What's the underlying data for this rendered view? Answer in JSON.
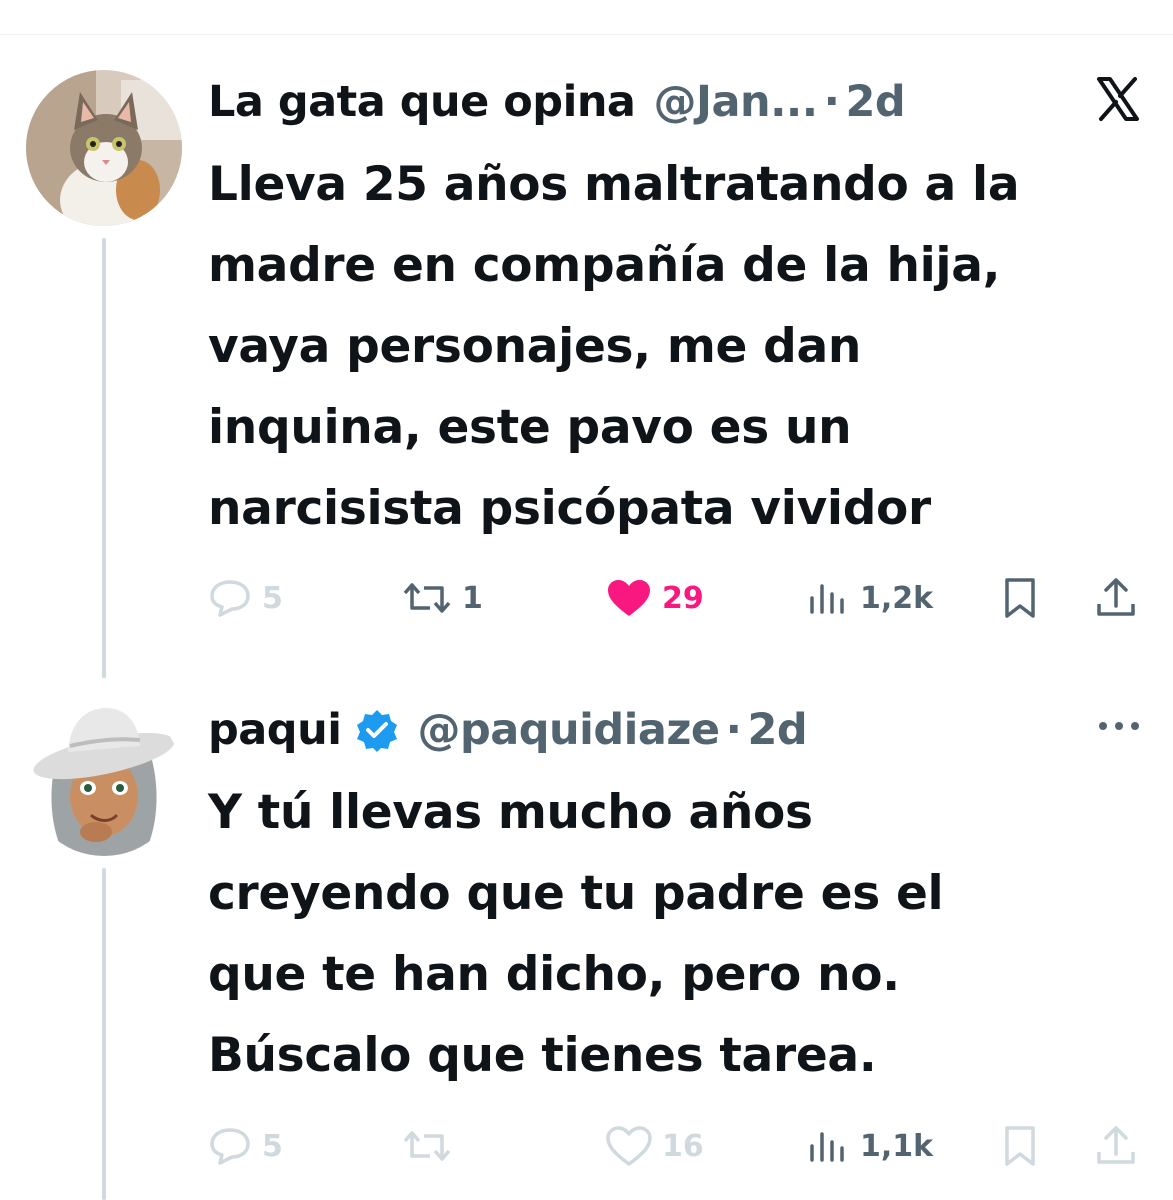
{
  "tweets": [
    {
      "display_name": "La gata que opina",
      "handle": "@Jan...",
      "separator": "·",
      "time": "2d",
      "text_lines": [
        "Lleva 25 años maltratando a la",
        "madre en compañía de la hija,",
        "vaya personajes,  me dan",
        "inquina, este pavo es un",
        "narcisista psicópata vividor"
      ],
      "stats": {
        "replies": "5",
        "reposts": "1",
        "likes": "29",
        "views": "1,2k"
      },
      "liked": true,
      "corner_icon": "x-logo-icon",
      "avatar_icon": "cat-avatar"
    },
    {
      "display_name": "paqui",
      "handle": "@paquidiaze",
      "separator": "·",
      "time": "2d",
      "verified": true,
      "text_lines": [
        "Y tú llevas mucho años",
        "creyendo que tu padre es el",
        "que te han dicho, pero no.",
        "Búscalo que tienes tarea."
      ],
      "stats": {
        "replies": "5",
        "reposts": "",
        "likes": "16",
        "views": "1,1k"
      },
      "liked": false,
      "corner_icon": "more-icon",
      "avatar_icon": "cowboy-memoji-avatar"
    }
  ],
  "colors": {
    "text_primary": "#0f1419",
    "text_secondary": "#536471",
    "like_active": "#f91880",
    "verified": "#1d9bf0",
    "thread_line": "#cfd9de"
  }
}
